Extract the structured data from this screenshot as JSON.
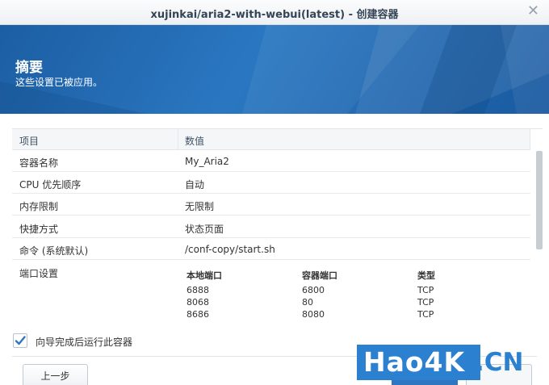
{
  "window": {
    "title": "xujinkai/aria2-with-webui(latest) - 创建容器",
    "close_glyph": "✕"
  },
  "banner": {
    "heading": "摘要",
    "subheading": "这些设置已被应用。"
  },
  "table": {
    "headers": {
      "item": "项目",
      "value": "数值"
    },
    "rows": [
      {
        "key": "容器名称",
        "value": "My_Aria2"
      },
      {
        "key": "CPU 优先顺序",
        "value": "自动"
      },
      {
        "key": "内存限制",
        "value": "无限制"
      },
      {
        "key": "快捷方式",
        "value": "状态页面"
      },
      {
        "key": "命令 (系统默认)",
        "value": "/conf-copy/start.sh"
      }
    ],
    "ports": {
      "label": "端口设置",
      "headers": {
        "local": "本地端口",
        "container": "容器端口",
        "type": "类型"
      },
      "rows": [
        {
          "local": "6888",
          "container": "6800",
          "type": "TCP"
        },
        {
          "local": "8068",
          "container": "80",
          "type": "TCP"
        },
        {
          "local": "8686",
          "container": "8080",
          "type": "TCP"
        }
      ]
    }
  },
  "options": {
    "run_after_wizard": {
      "label": "向导完成后运行此容器",
      "checked": true
    }
  },
  "footer": {
    "prev_label": "上一步"
  },
  "watermark": {
    "main": "Hao4K",
    "suffix": ".CN"
  },
  "colors": {
    "accent": "#2f77c0",
    "banner": "#1f64aa"
  }
}
